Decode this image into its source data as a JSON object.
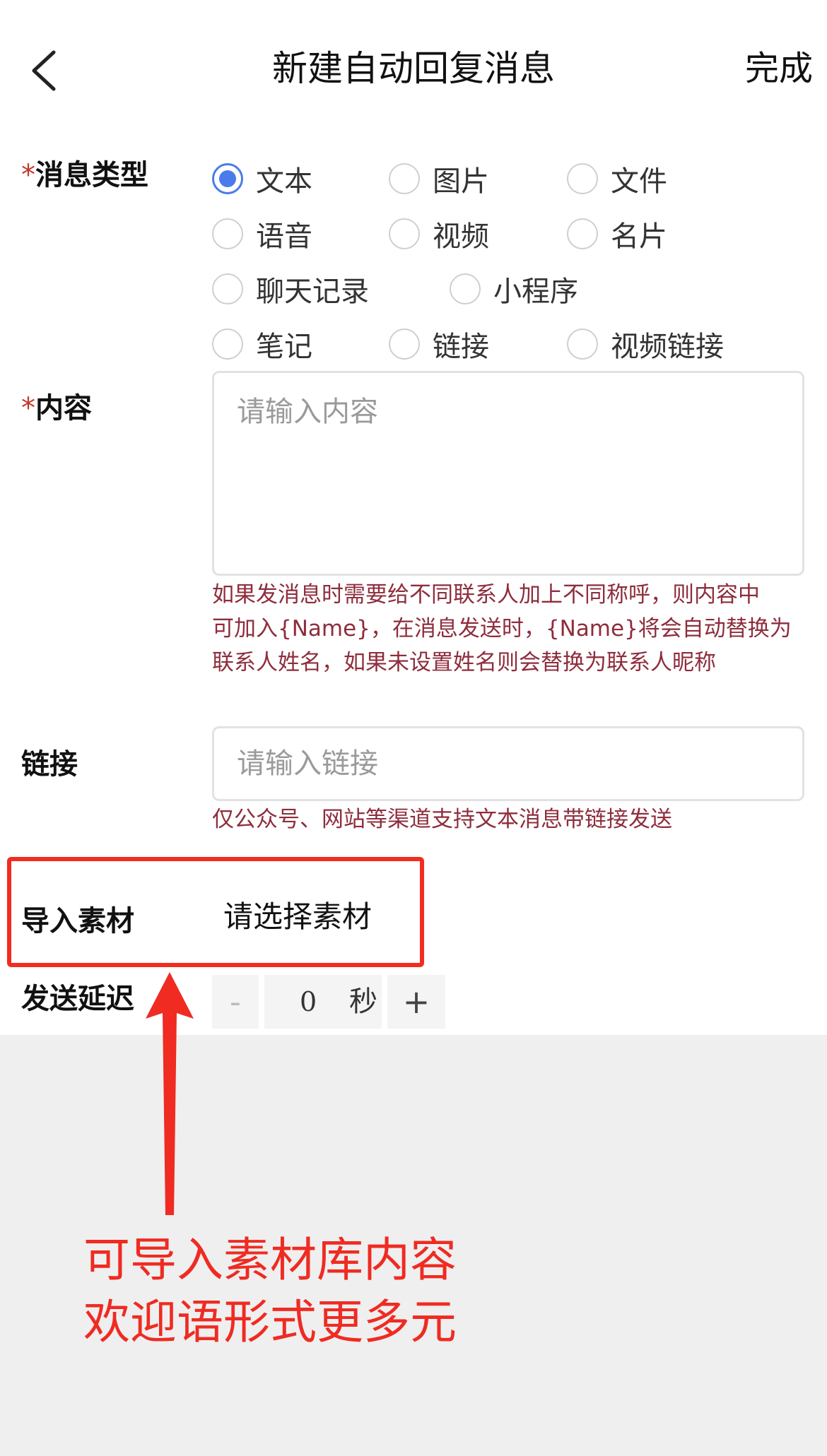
{
  "header": {
    "title": "新建自动回复消息",
    "done_label": "完成"
  },
  "form": {
    "required_mark": "*",
    "message_type": {
      "label": "消息类型",
      "options": [
        {
          "label": "文本",
          "checked": true
        },
        {
          "label": "图片",
          "checked": false
        },
        {
          "label": "文件",
          "checked": false
        },
        {
          "label": "语音",
          "checked": false
        },
        {
          "label": "视频",
          "checked": false
        },
        {
          "label": "名片",
          "checked": false
        },
        {
          "label": "聊天记录",
          "checked": false
        },
        {
          "label": "小程序",
          "checked": false
        },
        {
          "label": "笔记",
          "checked": false
        },
        {
          "label": "链接",
          "checked": false
        },
        {
          "label": "视频链接",
          "checked": false
        }
      ]
    },
    "content": {
      "label": "内容",
      "placeholder": "请输入内容",
      "hint_lines": [
        "如果发消息时需要给不同联系人加上不同称呼，则内容中",
        "可加入{Name}，在消息发送时，{Name}将会自动替换为",
        "联系人姓名，如果未设置姓名则会替换为联系人昵称"
      ]
    },
    "link": {
      "label": "链接",
      "placeholder": "请输入链接",
      "hint": "仅公众号、网站等渠道支持文本消息带链接发送"
    },
    "material": {
      "label": "导入素材",
      "button": "请选择素材"
    },
    "delay": {
      "label": "发送延迟",
      "minus": "-",
      "value": "0",
      "unit": "秒",
      "plus": "+"
    }
  },
  "annotation": {
    "line1": "可导入素材库内容",
    "line2": "欢迎语形式更多元",
    "color": "#ef2b22"
  },
  "colors": {
    "accent": "#4a7bea",
    "hint": "#8e2d3c",
    "highlight": "#f12c20"
  }
}
